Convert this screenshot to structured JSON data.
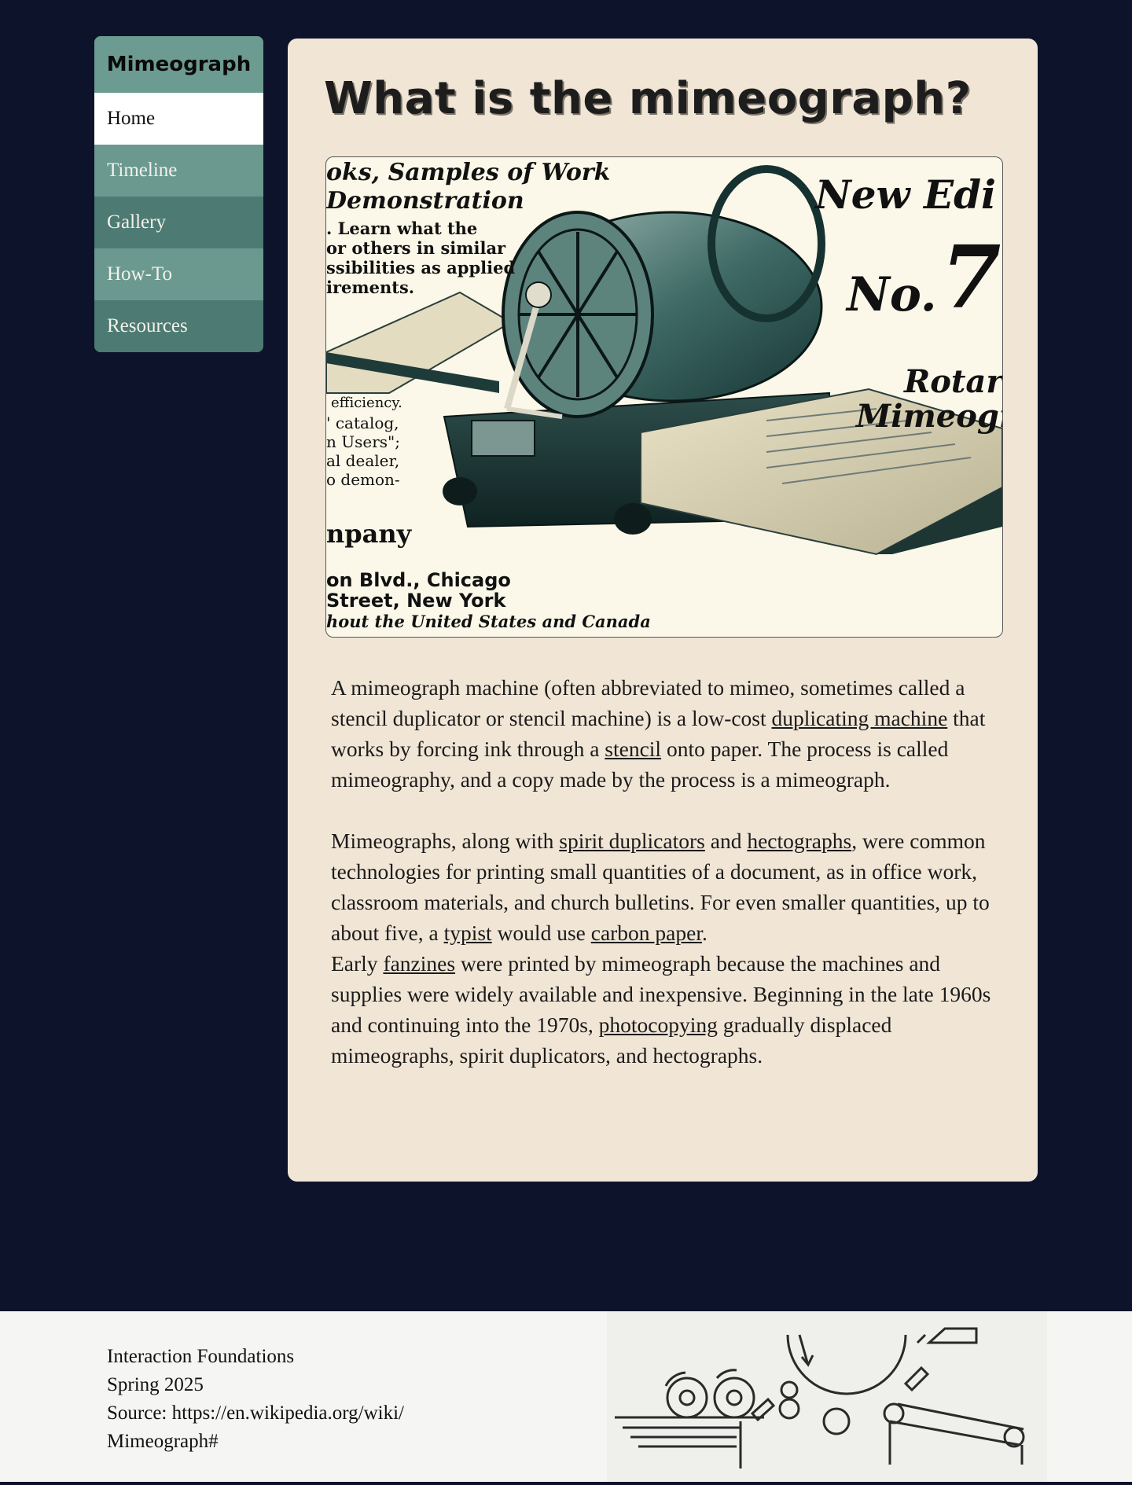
{
  "sidebar": {
    "brand": "Mimeograph",
    "items": [
      {
        "label": "Home"
      },
      {
        "label": "Timeline"
      },
      {
        "label": "Gallery"
      },
      {
        "label": "How-To"
      },
      {
        "label": "Resources"
      }
    ]
  },
  "main": {
    "title": "What is the mimeograph?",
    "image": {
      "ad_lines": {
        "l1": "oks, Samples of Work",
        "l2": "Demonstration",
        "l3": ". Learn what the",
        "l4": "or others in similar",
        "l5": "ssibilities as applied",
        "l6": "irements.",
        "l7": "efficiency.",
        "l8": "' catalog,",
        "l9": "n Users\";",
        "l10": "al dealer,",
        "l11": "o demon-",
        "l12": "npany",
        "l13": "on Blvd., Chicago",
        "l14": "Street, New York",
        "l15": "hout the United States and Canada",
        "r1": "New Edi",
        "r2": "No.",
        "r3": "7",
        "r4": "Rotar",
        "r5": "Mimeogr"
      }
    },
    "paragraph1": {
      "t1": "A mimeograph machine (often abbreviated to mimeo, sometimes called a stencil duplicator or stencil machine) is a low-cost ",
      "link1": "duplicating machine",
      "t2": " that works by forcing ink through a ",
      "link2": "stencil",
      "t3": " onto paper. The process is called mimeography, and a copy made by the process is a mimeograph."
    },
    "paragraph2": {
      "t1": "Mimeographs, along with ",
      "link1": "spirit duplicators",
      "t2": " and ",
      "link2": "hectographs",
      "t3": ", were common technologies for printing small quantities of a document, as in office work, classroom materials, and church bulletins. For even smaller quantities, up to about five, a ",
      "link3": "typist",
      "t4": " would use ",
      "link4": "carbon paper",
      "t5": ".",
      "t6": "Early ",
      "link5": "fanzines",
      "t7": " were printed by mimeograph because the machines and supplies were widely available and inexpensive. Beginning in the late 1960s and continuing into the 1970s, ",
      "link6": "photocopying",
      "t8": " gradually displaced mimeographs, spirit duplicators, and hectographs."
    }
  },
  "footer": {
    "line1": "Interaction Foundations",
    "line2": "Spring 2025",
    "line3": "Source: https://en.wikipedia.org/wiki/",
    "line4": "Mimeograph#"
  },
  "colors": {
    "background": "#0d132b",
    "sidebar": "#6c9b91",
    "sidebar_dark": "#4d7a72",
    "card": "#f1e6d6"
  },
  "icons": {
    "hero_image": "mimeograph-advertisement-illustration",
    "footer_image": "mimeograph-mechanism-diagram"
  }
}
